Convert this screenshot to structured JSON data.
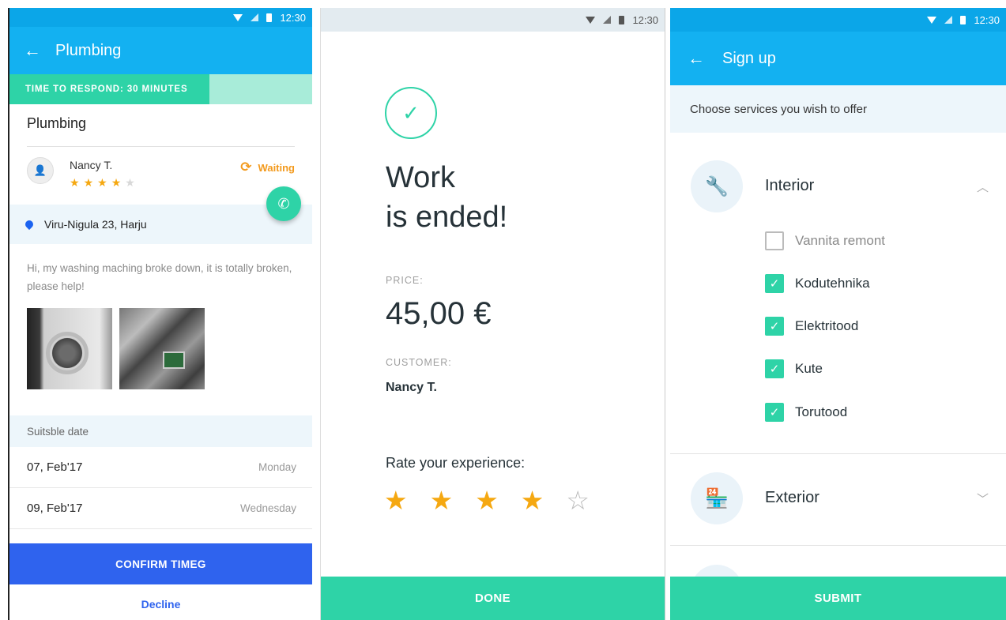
{
  "status": {
    "time": "12:30"
  },
  "job": {
    "title": "Plumbing",
    "time_to_respond": "TIME TO RESPOND: 30 MINUTES",
    "time_fraction": 0.66,
    "category": "Plumbing",
    "customer": {
      "name": "Nancy T.",
      "rating": 4,
      "rating_max": 5
    },
    "status": "Waiting",
    "address": "Viru-Nigula 23, Harju",
    "description": "Hi, my washing maching broke down, it is totally broken, please help!",
    "photos": [
      "washing-machine-photo",
      "circuit-board-photo"
    ],
    "date_header": "Suitsble date",
    "dates": [
      {
        "date": "07, Feb'17",
        "weekday": "Monday"
      },
      {
        "date": "09, Feb'17",
        "weekday": "Wednesday"
      }
    ],
    "confirm_label": "CONFIRM TIMEG",
    "decline_label": "Decline"
  },
  "ended": {
    "title": "Work\nis ended!",
    "price_label": "PRICE:",
    "price": "45,00 €",
    "customer_label": "CUSTOMER:",
    "customer": "Nancy T.",
    "rate_label": "Rate your experience:",
    "rating": 4,
    "rating_max": 5,
    "done_label": "DONE"
  },
  "signup": {
    "title": "Sign up",
    "subtitle": "Choose services you wish to offer",
    "categories": [
      {
        "name": "Interior",
        "icon": "wrench-icon",
        "expanded": true,
        "services": [
          {
            "label": "Vannita remont",
            "checked": false
          },
          {
            "label": "Kodutehnika",
            "checked": true
          },
          {
            "label": "Elektritood",
            "checked": true
          },
          {
            "label": "Kute",
            "checked": true
          },
          {
            "label": "Torutood",
            "checked": true
          }
        ]
      },
      {
        "name": "Exterior",
        "icon": "store-icon",
        "expanded": false
      }
    ],
    "submit_label": "SUBMIT"
  },
  "colors": {
    "primary": "#13b1f1",
    "accent": "#2ed3a7",
    "button_blue": "#2f63ee",
    "star": "#f5a811",
    "waiting": "#f39a1d"
  }
}
